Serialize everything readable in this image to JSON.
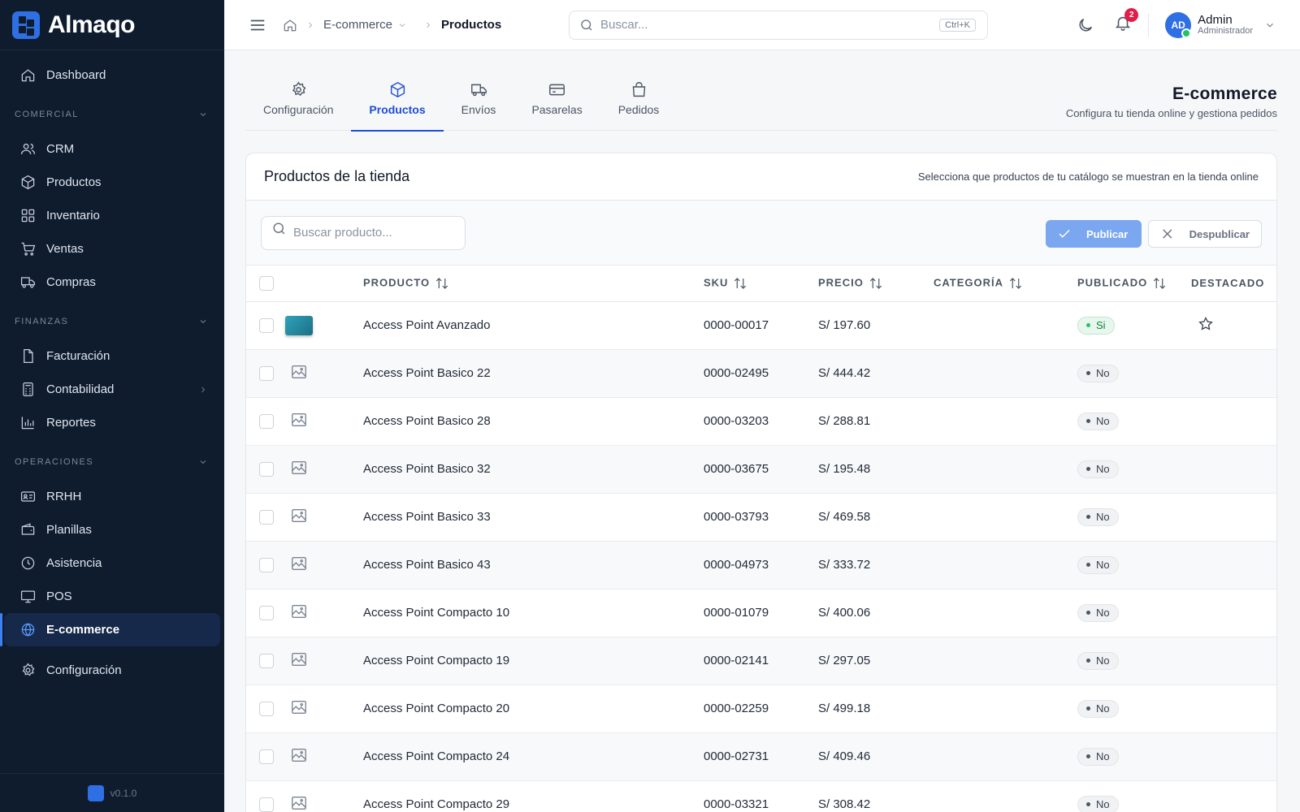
{
  "brand": {
    "name": "Almaqo",
    "version": "v0.1.0"
  },
  "sidebar": {
    "top": [
      {
        "label": "Dashboard",
        "icon": "home-icon"
      }
    ],
    "sections": [
      {
        "title": "COMERCIAL",
        "items": [
          {
            "label": "CRM",
            "icon": "users-icon"
          },
          {
            "label": "Productos",
            "icon": "box-icon"
          },
          {
            "label": "Inventario",
            "icon": "grid-icon"
          },
          {
            "label": "Ventas",
            "icon": "cart-icon"
          },
          {
            "label": "Compras",
            "icon": "truck-icon"
          }
        ]
      },
      {
        "title": "FINANZAS",
        "items": [
          {
            "label": "Facturación",
            "icon": "file-icon"
          },
          {
            "label": "Contabilidad",
            "icon": "calculator-icon"
          },
          {
            "label": "Reportes",
            "icon": "bar-chart-icon"
          }
        ]
      },
      {
        "title": "OPERACIONES",
        "items": [
          {
            "label": "RRHH",
            "icon": "id-card-icon"
          },
          {
            "label": "Planillas",
            "icon": "wallet-icon"
          },
          {
            "label": "Asistencia",
            "icon": "clock-icon"
          },
          {
            "label": "POS",
            "icon": "monitor-icon"
          },
          {
            "label": "E-commerce",
            "icon": "globe-icon",
            "active": true
          }
        ]
      }
    ],
    "bottom": [
      {
        "label": "Configuración",
        "icon": "gear-icon"
      }
    ]
  },
  "header": {
    "breadcrumb": [
      "E-commerce",
      "Productos"
    ],
    "search_placeholder": "Buscar...",
    "shortcut": "Ctrl+K",
    "notifications": "2",
    "user": {
      "initials": "AD",
      "name": "Admin",
      "role": "Administrador"
    }
  },
  "tabs": [
    {
      "label": "Configuración",
      "icon": "gear-icon"
    },
    {
      "label": "Productos",
      "icon": "box-icon",
      "active": true
    },
    {
      "label": "Envíos",
      "icon": "truck-icon"
    },
    {
      "label": "Pasarelas",
      "icon": "credit-card-icon"
    },
    {
      "label": "Pedidos",
      "icon": "shopping-bag-icon"
    }
  ],
  "page": {
    "title": "E-commerce",
    "subtitle": "Configura tu tienda online y gestiona pedidos"
  },
  "card": {
    "title": "Productos de la tienda",
    "subtitle": "Selecciona que productos de tu catálogo se muestran en la tienda online",
    "search_placeholder": "Buscar producto...",
    "publish_label": "Publicar",
    "unpublish_label": "Despublicar"
  },
  "table": {
    "columns": {
      "producto": "PRODUCTO",
      "sku": "SKU",
      "precio": "PRECIO",
      "categoria": "CATEGORÍA",
      "publicado": "PUBLICADO",
      "destacado": "DESTACADO"
    },
    "rows": [
      {
        "name": "Access Point Avanzado",
        "sku": "0000-00017",
        "price": "S/ 197.60",
        "category": "",
        "published": "Si",
        "has_image": true,
        "featured_star": true
      },
      {
        "name": "Access Point Basico 22",
        "sku": "0000-02495",
        "price": "S/ 444.42",
        "category": "",
        "published": "No"
      },
      {
        "name": "Access Point Basico 28",
        "sku": "0000-03203",
        "price": "S/ 288.81",
        "category": "",
        "published": "No"
      },
      {
        "name": "Access Point Basico 32",
        "sku": "0000-03675",
        "price": "S/ 195.48",
        "category": "",
        "published": "No"
      },
      {
        "name": "Access Point Basico 33",
        "sku": "0000-03793",
        "price": "S/ 469.58",
        "category": "",
        "published": "No"
      },
      {
        "name": "Access Point Basico 43",
        "sku": "0000-04973",
        "price": "S/ 333.72",
        "category": "",
        "published": "No"
      },
      {
        "name": "Access Point Compacto 10",
        "sku": "0000-01079",
        "price": "S/ 400.06",
        "category": "",
        "published": "No"
      },
      {
        "name": "Access Point Compacto 19",
        "sku": "0000-02141",
        "price": "S/ 297.05",
        "category": "",
        "published": "No"
      },
      {
        "name": "Access Point Compacto 20",
        "sku": "0000-02259",
        "price": "S/ 499.18",
        "category": "",
        "published": "No"
      },
      {
        "name": "Access Point Compacto 24",
        "sku": "0000-02731",
        "price": "S/ 409.46",
        "category": "",
        "published": "No"
      },
      {
        "name": "Access Point Compacto 29",
        "sku": "0000-03321",
        "price": "S/ 308.42",
        "category": "",
        "published": "No"
      }
    ]
  }
}
